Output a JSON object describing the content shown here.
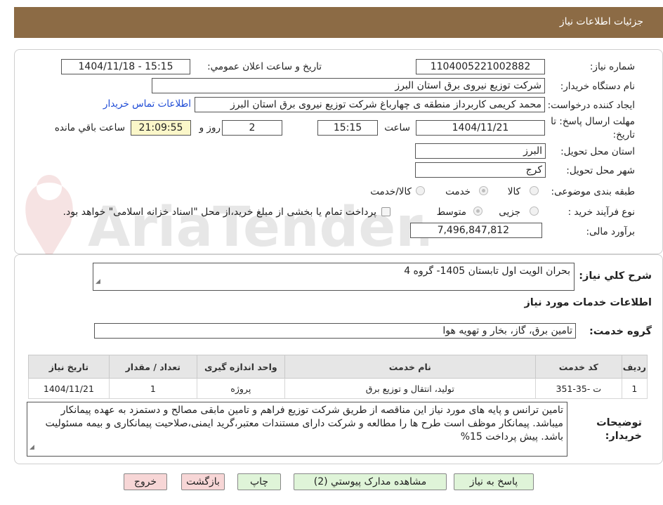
{
  "header": {
    "title": "جزئیات اطلاعات نیاز"
  },
  "form": {
    "need_number_label": "شماره نیاز:",
    "need_number": "1104005221002882",
    "announce_label": "تاریخ و ساعت اعلان عمومي:",
    "announce_value": "1404/11/18 - 15:15",
    "buyer_org_label": "نام دستگاه خریدار:",
    "buyer_org": "شرکت توزیع نیروی برق استان البرز",
    "requester_label": "ایجاد کننده درخواست:",
    "requester": "محمد کریمی کاربرداز منطقه ی چهارباغ شرکت توزیع نیروی برق استان البرز",
    "contact_link": "اطلاعات تماس خریدار",
    "deadline_label_1": "مهلت ارسال پاسخ: تا",
    "deadline_label_2": "تاریخ:",
    "deadline_date": "1404/11/21",
    "time_label": "ساعت",
    "deadline_time": "15:15",
    "days_value": "2",
    "days_label": "روز و",
    "remaining_time": "21:09:55",
    "remaining_label": "ساعت باقي مانده",
    "province_label": "استان محل تحویل:",
    "province": "البرز",
    "city_label": "شهر محل تحویل:",
    "city": "کرج",
    "category_label": "طبقه بندی موضوعی:",
    "category_options": [
      "کالا",
      "خدمت",
      "کالا/خدمت"
    ],
    "category_selected": "خدمت",
    "process_label": "نوع فرآیند خرید :",
    "process_options": [
      "جزیی",
      "متوسط"
    ],
    "process_selected": "متوسط",
    "payment_note": "پرداخت تمام یا بخشی از مبلغ خرید،از محل \"اسناد خزانه اسلامی\" خواهد بود.",
    "budget_label": "برآورد مالی:",
    "budget": "7,496,847,812"
  },
  "summary": {
    "label": "شرح کلي نیاز:",
    "value": "بحران الویت اول تابستان 1405- گروه 4"
  },
  "services": {
    "section_title": "اطلاعات خدمات مورد نیاز",
    "group_label": "گروه خدمت:",
    "group_value": "تامین برق، گاز، بخار و تهویه هوا",
    "table": {
      "headers": [
        "ردیف",
        "کد خدمت",
        "نام خدمت",
        "واحد اندازه گیری",
        "تعداد / مقدار",
        "تاریخ نیاز"
      ],
      "rows": [
        [
          "1",
          "ت -35-351",
          "تولید، انتقال و توزیع برق",
          "پروژه",
          "1",
          "1404/11/21"
        ]
      ]
    }
  },
  "buyer_notes": {
    "label_1": "توضیحات",
    "label_2": "خریدار:",
    "value": "تامین ترانس و پایه های مورد نیاز این مناقصه از طریق شرکت توزیع فراهم و تامین مابقی مصالح و دستمزد به عهده پیمانکار میباشد. پیمانکار موظف است طرح ها را مطالعه و شرکت دارای مستندات معتبر،گرید ایمنی،صلاحیت پیمانکاری و بیمه مسئولیت باشد. پیش پرداخت 15%"
  },
  "buttons": {
    "reply": "پاسخ به نیاز",
    "attachments": "مشاهده مدارک پیوستي (2)",
    "print": "چاپ",
    "back": "بازگشت",
    "exit": "خروج"
  },
  "watermark": {
    "text": "AriaTender.net"
  },
  "colors": {
    "header_bg": "#8c6b45",
    "link": "#1e4bd6",
    "green_button": "#dff4d8",
    "red_button": "#f7d6d6",
    "remaining_bg": "#fbf7c9"
  }
}
